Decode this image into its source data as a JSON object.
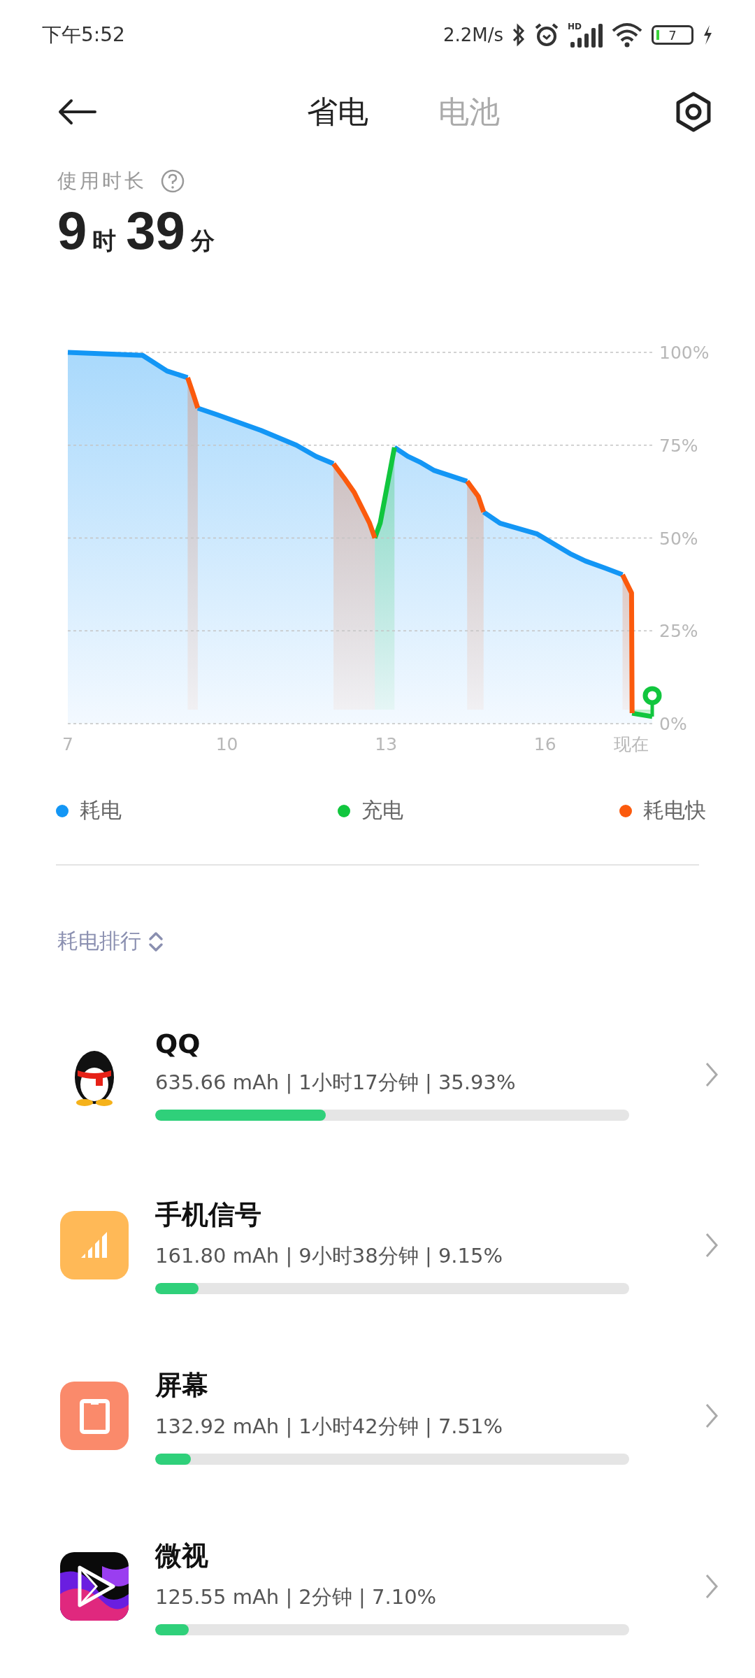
{
  "status_bar": {
    "time": "下午5:52",
    "speed": "2.2M/s",
    "battery": "7",
    "network_type": "HD"
  },
  "tabs": [
    {
      "label": "省电",
      "selected": true
    },
    {
      "label": "电池",
      "selected": false
    }
  ],
  "usage": {
    "label": "使用时长",
    "hours": "9",
    "hours_unit": "时",
    "minutes": "39",
    "minutes_unit": "分"
  },
  "chart": {
    "chart_data": {
      "type": "line",
      "grid": true,
      "x": [
        7.0,
        8.41,
        8.87,
        9.26,
        9.36,
        9.45,
        9.82,
        10.64,
        11.31,
        11.68,
        12.01,
        12.21,
        12.4,
        12.69,
        12.79,
        12.89,
        13.16,
        13.41,
        13.66,
        13.91,
        14.53,
        14.74,
        14.84,
        15.15,
        15.85,
        16.47,
        16.76,
        17.13,
        17.46,
        17.63,
        17.64,
        18.02
      ],
      "series": [
        {
          "name": "耗电",
          "color": "#1396f5",
          "values": [
            100,
            99.2,
            95,
            93.2,
            null,
            85,
            83.2,
            79,
            75,
            72,
            70,
            null,
            null,
            null,
            null,
            null,
            74.4,
            72,
            70.3,
            68.2,
            65.3,
            null,
            57,
            54,
            51.1,
            45.8,
            43.8,
            41.9,
            40.1,
            null,
            null,
            null
          ]
        },
        {
          "name": "充电",
          "color": "#11c63e",
          "values": [
            null,
            null,
            null,
            null,
            null,
            null,
            null,
            null,
            null,
            null,
            null,
            null,
            null,
            null,
            50,
            54,
            74.4,
            null,
            null,
            null,
            null,
            null,
            null,
            null,
            null,
            null,
            null,
            null,
            null,
            null,
            2.8,
            1.9
          ]
        },
        {
          "name": "耗电快",
          "color": "#fb5a0d",
          "values": [
            null,
            null,
            null,
            93.2,
            89,
            85,
            null,
            null,
            null,
            null,
            70,
            66.2,
            62.3,
            54,
            50,
            null,
            null,
            null,
            null,
            null,
            65.3,
            61.2,
            57,
            null,
            null,
            null,
            null,
            null,
            40.1,
            35.2,
            2.8,
            null
          ]
        }
      ],
      "xlim": [
        7,
        18.02
      ],
      "ylim": [
        0,
        100
      ],
      "xticks": [
        7,
        10,
        13,
        16,
        {
          "value": 17.63,
          "label": "现在"
        }
      ],
      "yticks": [
        {
          "value": 0,
          "label": "0%"
        },
        {
          "value": 25,
          "label": "25%"
        },
        {
          "value": 50,
          "label": "50%"
        },
        {
          "value": 75,
          "label": "75%"
        },
        {
          "value": 100,
          "label": "100%"
        }
      ]
    }
  },
  "ranking": {
    "title": "耗电排行"
  },
  "items": [
    {
      "kind": "penguin",
      "name": "QQ",
      "detail": "635.66 mAh | 1小时17分钟 | 35.93%",
      "level": 0.3593
    },
    {
      "kind": "signal",
      "name": "手机信号",
      "detail": "161.80 mAh | 9小时38分钟 | 9.15%",
      "level": 0.0915
    },
    {
      "kind": "screen",
      "name": "屏幕",
      "detail": "132.92 mAh | 1小时42分钟 | 7.51%",
      "level": 0.0751
    },
    {
      "kind": "video",
      "name": "微视",
      "detail": "125.55 mAh | 2分钟 | 7.10%",
      "level": 0.071
    }
  ]
}
